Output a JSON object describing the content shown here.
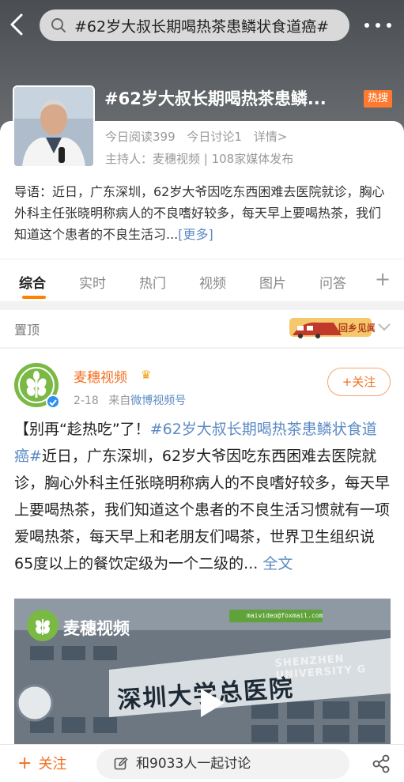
{
  "search": {
    "query": "#62岁大叔长期喝热茶患鳞状食道癌#"
  },
  "topic": {
    "title": "#62岁大叔长期喝热茶患鳞...",
    "hot_badge": "热搜",
    "stats": {
      "reads": "今日阅读399",
      "discussions": "今日讨论1",
      "details": "详情>"
    },
    "host": "主持人：麦穗视频 | 108家媒体发布",
    "intro": "导语：近日，广东深圳，62岁大爷因吃东西困难去医院就诊，胸心外科主任张晓明称病人的不良嗜好较多，每天早上要喝热茶，我们知道这个患者的不良生活习...",
    "intro_more": "[更多]"
  },
  "tabs": [
    {
      "label": "综合"
    },
    {
      "label": "实时"
    },
    {
      "label": "热门"
    },
    {
      "label": "视频"
    },
    {
      "label": "图片"
    },
    {
      "label": "问答"
    }
  ],
  "tab_plus": "+",
  "pinned": {
    "label": "置顶",
    "promo_text": "回乡见闻"
  },
  "post": {
    "author": "麦穗视频",
    "date": "2-18",
    "source_prefix": "来自",
    "source": "微博视频号",
    "follow_label": "+关注",
    "text_open": "【别再“趁热吃”了！",
    "hashtag": "#62岁大叔长期喝热茶患鳞状食道癌#",
    "text_body": "近日，广东深圳，62岁大爷因吃东西困难去医院就诊，胸心外科主任张晓明称病人的不良嗜好较多，每天早上要喝热茶，我们知道这个患者的不良生活习惯就有一项爱喝热茶，每天早上和老朋友们喝茶，世界卫生组织说65度以上的餐饮定级为一个二级的...",
    "full_text": "全文",
    "video": {
      "brand": "麦穗视频",
      "mail": "maivideo@foxmail.com",
      "sign_en": "SHENZHEN UNIVERSITY G",
      "sign_cn": "深圳大学总医院"
    }
  },
  "bottom": {
    "follow_plus": "+",
    "follow_label": "关注",
    "discuss_label": "和9033人一起讨论"
  },
  "colors": {
    "accent": "#ff8200",
    "link": "#5b8ac4",
    "author": "#f36f21",
    "hot": "#ff7a30"
  }
}
